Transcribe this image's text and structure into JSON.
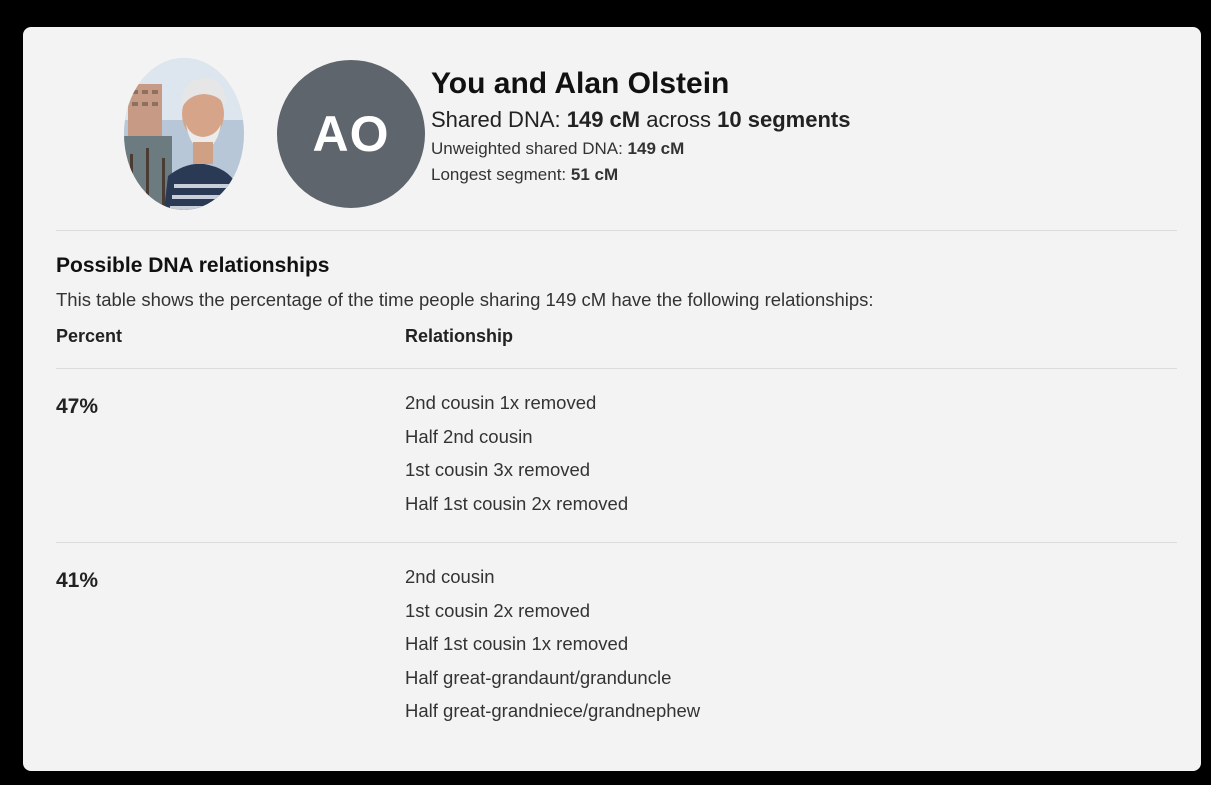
{
  "match": {
    "title": "You and Alan Olstein",
    "initials": "AO",
    "shared_prefix": "Shared DNA: ",
    "shared_cm": "149 cM",
    "shared_mid": " across ",
    "shared_segments": "10 segments",
    "unweighted_label": "Unweighted shared DNA: ",
    "unweighted_value": "149 cM",
    "longest_label": "Longest segment: ",
    "longest_value": "51 cM"
  },
  "relationships": {
    "section_title": "Possible DNA relationships",
    "description": "This table shows the percentage of the time people sharing 149 cM have the following relationships:",
    "col_percent": "Percent",
    "col_relationship": "Relationship",
    "rows": [
      {
        "percent": "47%",
        "relations": [
          "2nd cousin 1x removed",
          "Half 2nd cousin",
          "1st cousin 3x removed",
          "Half 1st cousin 2x removed"
        ]
      },
      {
        "percent": "41%",
        "relations": [
          "2nd cousin",
          "1st cousin 2x removed",
          "Half 1st cousin 1x removed",
          "Half great-grandaunt/granduncle",
          "Half great-grandniece/grandnephew"
        ]
      }
    ]
  },
  "colors": {
    "avatar_bg": "#5f656d",
    "card_bg": "#f3f3f3",
    "frame_bg": "#000000"
  }
}
